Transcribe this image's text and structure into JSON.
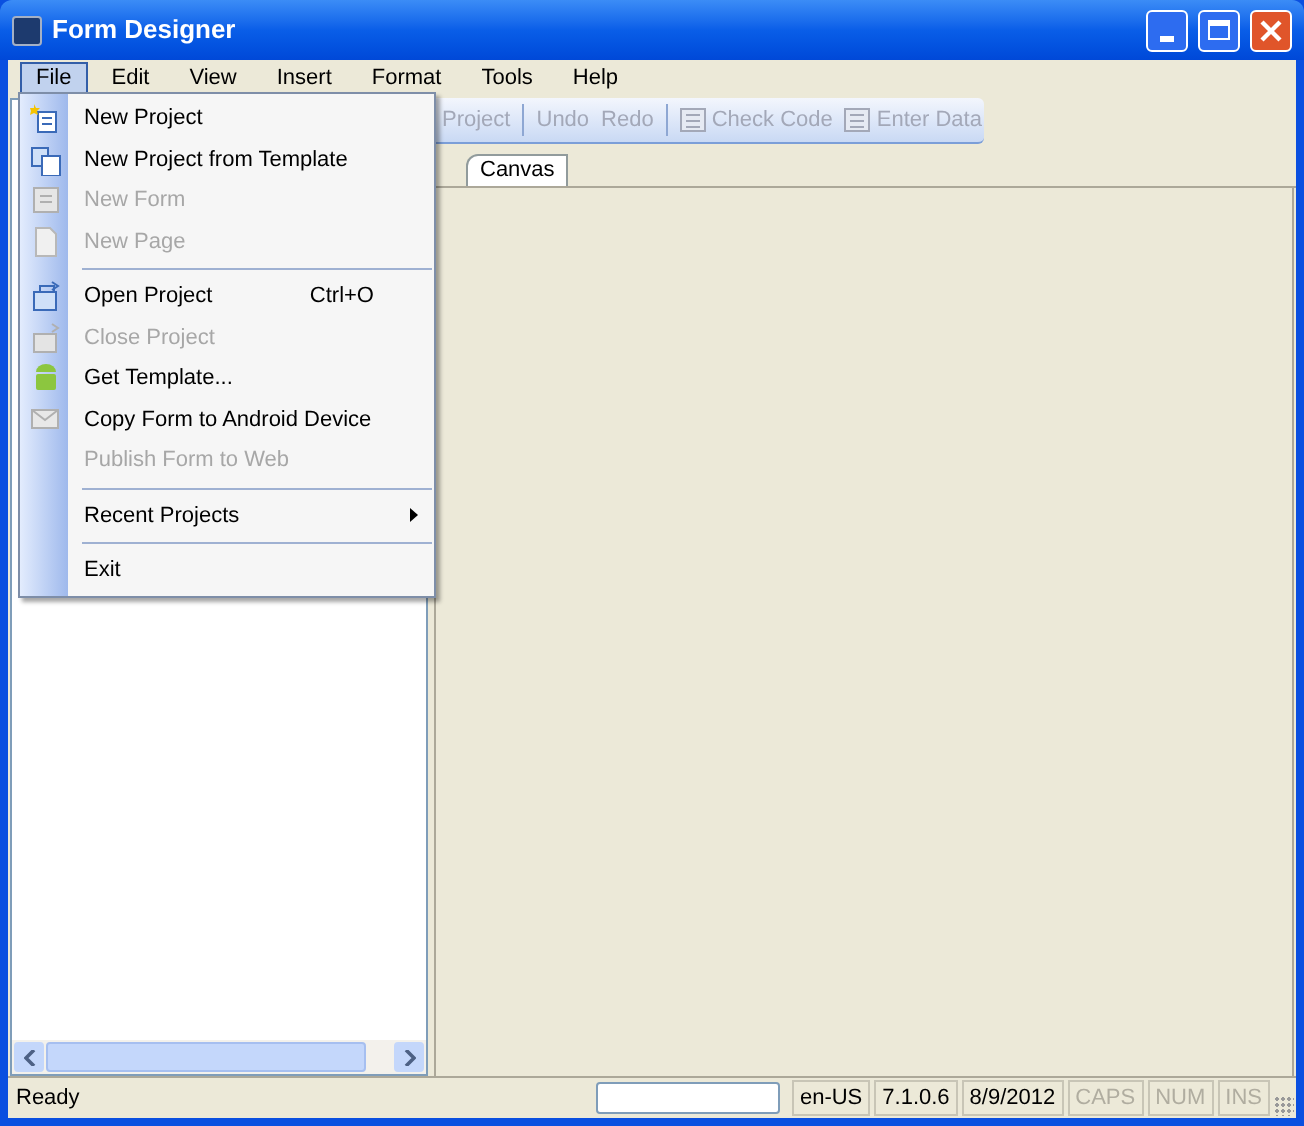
{
  "window": {
    "title": "Form Designer"
  },
  "menu_bar": [
    {
      "label": "File",
      "selected": true
    },
    {
      "label": "Edit",
      "selected": false
    },
    {
      "label": "View",
      "selected": false
    },
    {
      "label": "Insert",
      "selected": false
    },
    {
      "label": "Format",
      "selected": false
    },
    {
      "label": "Tools",
      "selected": false
    },
    {
      "label": "Help",
      "selected": false
    }
  ],
  "toolbar": [
    {
      "label": "Project",
      "disabled": true,
      "kind": "text"
    },
    {
      "kind": "separator"
    },
    {
      "label": "Undo",
      "disabled": true,
      "kind": "text"
    },
    {
      "label": "Redo",
      "disabled": true,
      "kind": "text"
    },
    {
      "kind": "separator"
    },
    {
      "label": "Check Code",
      "disabled": true,
      "kind": "check"
    },
    {
      "label": "Enter Data",
      "disabled": true,
      "kind": "data"
    }
  ],
  "tabs": [
    {
      "label": "Canvas",
      "selected": true
    }
  ],
  "file_menu": [
    {
      "kind": "item",
      "label": "New Project",
      "disabled": false
    },
    {
      "kind": "item",
      "label": "New Project from Template",
      "disabled": false
    },
    {
      "kind": "item",
      "label": "New Form",
      "disabled": true
    },
    {
      "kind": "item",
      "label": "New Page",
      "disabled": true
    },
    {
      "kind": "separator"
    },
    {
      "kind": "item",
      "label": "Open Project",
      "shortcut": "Ctrl+O",
      "disabled": false
    },
    {
      "kind": "item",
      "label": "Close Project",
      "disabled": true
    },
    {
      "kind": "item",
      "label": "Get Template...",
      "disabled": false
    },
    {
      "kind": "item",
      "label": "Copy Form to Android Device",
      "disabled": false
    },
    {
      "kind": "item",
      "label": "Publish Form to Web",
      "disabled": true
    },
    {
      "kind": "separator"
    },
    {
      "kind": "submenu",
      "label": "Recent Projects",
      "disabled": false
    },
    {
      "kind": "separator"
    },
    {
      "kind": "item",
      "label": "Exit",
      "disabled": false
    }
  ],
  "status_bar": [
    {
      "kind": "text",
      "label": "Ready",
      "disabled": false
    },
    {
      "kind": "field"
    },
    {
      "kind": "panel",
      "label": "en-US",
      "disabled": false
    },
    {
      "kind": "panel",
      "label": "7.1.0.6",
      "disabled": false
    },
    {
      "kind": "panel",
      "label": "8/9/2012",
      "disabled": false
    },
    {
      "kind": "panel",
      "label": "CAPS",
      "disabled": true
    },
    {
      "kind": "panel",
      "label": "NUM",
      "disabled": true
    },
    {
      "kind": "panel",
      "label": "INS",
      "disabled": true
    }
  ]
}
